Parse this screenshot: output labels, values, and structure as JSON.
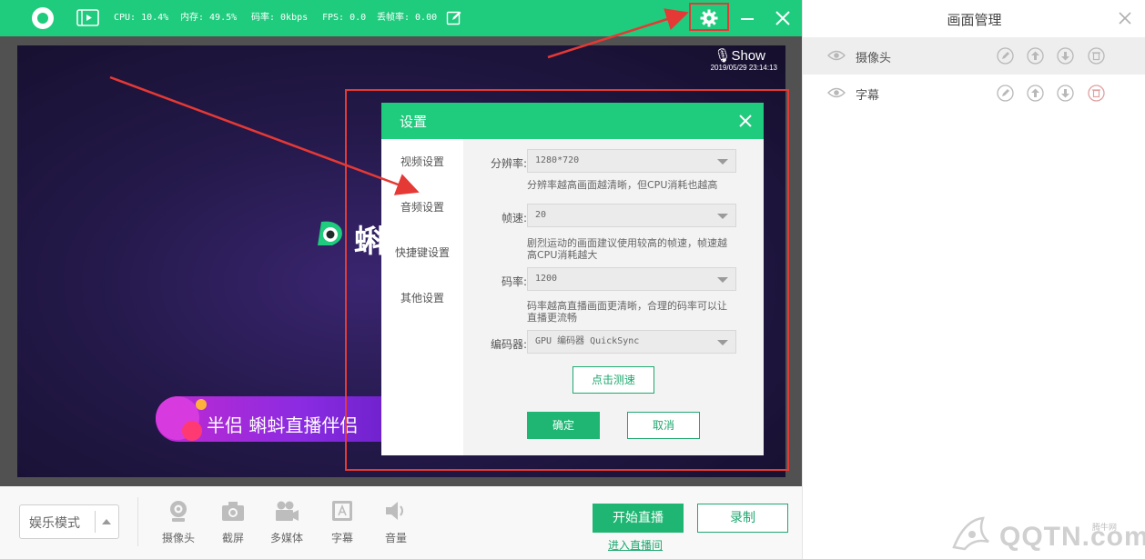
{
  "colors": {
    "brand": "#1fcb7d",
    "button": "#1fb673",
    "highlight": "#e53935"
  },
  "topbar": {
    "cpu": "CPU: 10.4%",
    "memory": "内存: 49.5%",
    "bitrate": "码率: 0kbps",
    "fps": "FPS: 0.0",
    "drop": "丢帧率: 0.00",
    "icons": [
      "app-logo",
      "video-icon",
      "edit-icon",
      "gear-icon",
      "minimize-icon",
      "close-icon"
    ]
  },
  "preview": {
    "show_logo": "🎙Show",
    "timestamp": "2019/05/29 23:14:13",
    "brand_text": "蝌",
    "banner_text": "半侣 蝌蚪直播伴侣"
  },
  "dialog": {
    "title": "设置",
    "nav": [
      "视频设置",
      "音频设置",
      "快捷键设置",
      "其他设置"
    ],
    "resolution_label": "分辨率:",
    "resolution_value": "1280*720",
    "resolution_hint": "分辨率越高画面越清晰，但CPU消耗也越高",
    "fps_label": "帧速:",
    "fps_value": "20",
    "fps_hint": "剧烈运动的画面建议使用较高的帧速，帧速越高CPU消耗越大",
    "bitrate_label": "码率:",
    "bitrate_value": "1200",
    "bitrate_hint": "码率越高直播画面更清晰，合理的码率可以让直播更流畅",
    "encoder_label": "编码器:",
    "encoder_value": "GPU 编码器 QuickSync",
    "test_button": "点击测速",
    "ok_button": "确定",
    "cancel_button": "取消"
  },
  "bottombar": {
    "mode": "娱乐模式",
    "tools": [
      "摄像头",
      "截屏",
      "多媒体",
      "字幕",
      "音量"
    ],
    "start_button": "开始直播",
    "record_button": "录制",
    "enter_link": "进入直播间"
  },
  "right_panel": {
    "title": "画面管理",
    "layers": [
      {
        "name": "摄像头"
      },
      {
        "name": "字幕"
      }
    ]
  },
  "watermark": {
    "text": "QQTN.com",
    "small": "腾牛网"
  }
}
